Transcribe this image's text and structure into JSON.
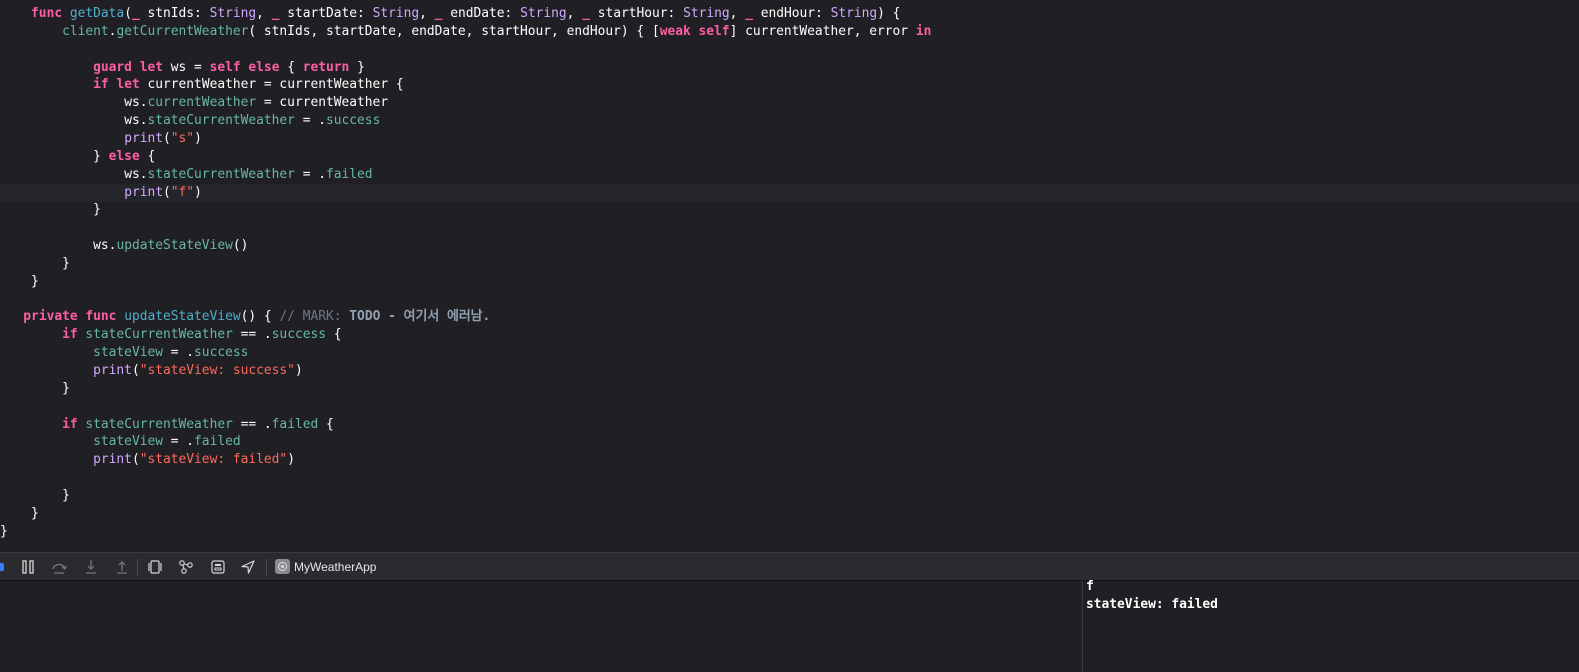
{
  "editor": {
    "current_line_index": 10,
    "lines": [
      [
        {
          "t": "    "
        },
        {
          "t": "func",
          "c": "kw"
        },
        {
          "t": " "
        },
        {
          "t": "getData",
          "c": "dc"
        },
        {
          "t": "("
        },
        {
          "t": "_",
          "c": "kw"
        },
        {
          "t": " stnIds: "
        },
        {
          "t": "String",
          "c": "ty"
        },
        {
          "t": ", "
        },
        {
          "t": "_",
          "c": "kw"
        },
        {
          "t": " startDate: "
        },
        {
          "t": "String",
          "c": "ty"
        },
        {
          "t": ", "
        },
        {
          "t": "_",
          "c": "kw"
        },
        {
          "t": " endDate: "
        },
        {
          "t": "String",
          "c": "ty"
        },
        {
          "t": ", "
        },
        {
          "t": "_",
          "c": "kw"
        },
        {
          "t": " startHour: "
        },
        {
          "t": "String",
          "c": "ty"
        },
        {
          "t": ", "
        },
        {
          "t": "_",
          "c": "kw"
        },
        {
          "t": " endHour: "
        },
        {
          "t": "String",
          "c": "ty"
        },
        {
          "t": ") {"
        }
      ],
      [
        {
          "t": "        "
        },
        {
          "t": "client",
          "c": "fn"
        },
        {
          "t": "."
        },
        {
          "t": "getCurrentWeather",
          "c": "fn"
        },
        {
          "t": "( stnIds, startDate, endDate, startHour, endHour) { ["
        },
        {
          "t": "weak",
          "c": "kw"
        },
        {
          "t": " "
        },
        {
          "t": "self",
          "c": "kw"
        },
        {
          "t": "] currentWeather, error "
        },
        {
          "t": "in",
          "c": "kw"
        }
      ],
      [],
      [
        {
          "t": "            "
        },
        {
          "t": "guard",
          "c": "kw"
        },
        {
          "t": " "
        },
        {
          "t": "let",
          "c": "kw"
        },
        {
          "t": " ws = "
        },
        {
          "t": "self",
          "c": "kw"
        },
        {
          "t": " "
        },
        {
          "t": "else",
          "c": "kw"
        },
        {
          "t": " { "
        },
        {
          "t": "return",
          "c": "kw"
        },
        {
          "t": " }"
        }
      ],
      [
        {
          "t": "            "
        },
        {
          "t": "if",
          "c": "kw"
        },
        {
          "t": " "
        },
        {
          "t": "let",
          "c": "kw"
        },
        {
          "t": " currentWeather = currentWeather {"
        }
      ],
      [
        {
          "t": "                "
        },
        {
          "t": "ws."
        },
        {
          "t": "currentWeather",
          "c": "fn"
        },
        {
          "t": " = currentWeather"
        }
      ],
      [
        {
          "t": "                "
        },
        {
          "t": "ws."
        },
        {
          "t": "stateCurrentWeather",
          "c": "fn"
        },
        {
          "t": " = ."
        },
        {
          "t": "success",
          "c": "fn"
        }
      ],
      [
        {
          "t": "                "
        },
        {
          "t": "print",
          "c": "ty"
        },
        {
          "t": "("
        },
        {
          "t": "\"s\"",
          "c": "st"
        },
        {
          "t": ")"
        }
      ],
      [
        {
          "t": "            } "
        },
        {
          "t": "else",
          "c": "kw"
        },
        {
          "t": " {"
        }
      ],
      [
        {
          "t": "                "
        },
        {
          "t": "ws."
        },
        {
          "t": "stateCurrentWeather",
          "c": "fn"
        },
        {
          "t": " = ."
        },
        {
          "t": "failed",
          "c": "fn"
        }
      ],
      [
        {
          "t": "                "
        },
        {
          "t": "print",
          "c": "ty"
        },
        {
          "t": "("
        },
        {
          "t": "\"f\"",
          "c": "st"
        },
        {
          "t": ")"
        }
      ],
      [
        {
          "t": "            }"
        }
      ],
      [],
      [
        {
          "t": "            "
        },
        {
          "t": "ws."
        },
        {
          "t": "updateStateView",
          "c": "fn"
        },
        {
          "t": "()"
        }
      ],
      [
        {
          "t": "        }"
        }
      ],
      [
        {
          "t": "    }"
        }
      ],
      [],
      [
        {
          "t": "   "
        },
        {
          "t": "private",
          "c": "kw"
        },
        {
          "t": " "
        },
        {
          "t": "func",
          "c": "kw"
        },
        {
          "t": " "
        },
        {
          "t": "updateStateView",
          "c": "dc"
        },
        {
          "t": "() { "
        },
        {
          "t": "// MARK: ",
          "c": "cm"
        },
        {
          "t": "TODO",
          "c": "mk"
        },
        {
          "t": " - 여기서 에러남.",
          "c": "mk"
        }
      ],
      [
        {
          "t": "        "
        },
        {
          "t": "if",
          "c": "kw"
        },
        {
          "t": " "
        },
        {
          "t": "stateCurrentWeather",
          "c": "fn"
        },
        {
          "t": " == ."
        },
        {
          "t": "success",
          "c": "fn"
        },
        {
          "t": " {"
        }
      ],
      [
        {
          "t": "            "
        },
        {
          "t": "stateView",
          "c": "fn"
        },
        {
          "t": " = ."
        },
        {
          "t": "success",
          "c": "fn"
        }
      ],
      [
        {
          "t": "            "
        },
        {
          "t": "print",
          "c": "ty"
        },
        {
          "t": "("
        },
        {
          "t": "\"stateView: success\"",
          "c": "st"
        },
        {
          "t": ")"
        }
      ],
      [
        {
          "t": "        }"
        }
      ],
      [],
      [
        {
          "t": "        "
        },
        {
          "t": "if",
          "c": "kw"
        },
        {
          "t": " "
        },
        {
          "t": "stateCurrentWeather",
          "c": "fn"
        },
        {
          "t": " == ."
        },
        {
          "t": "failed",
          "c": "fn"
        },
        {
          "t": " {"
        }
      ],
      [
        {
          "t": "            "
        },
        {
          "t": "stateView",
          "c": "fn"
        },
        {
          "t": " = ."
        },
        {
          "t": "failed",
          "c": "fn"
        }
      ],
      [
        {
          "t": "            "
        },
        {
          "t": "print",
          "c": "ty"
        },
        {
          "t": "("
        },
        {
          "t": "\"stateView: failed\"",
          "c": "st"
        },
        {
          "t": ")"
        }
      ],
      [],
      [
        {
          "t": "        }"
        }
      ],
      [
        {
          "t": "    }"
        }
      ],
      [
        {
          "t": "}"
        }
      ]
    ]
  },
  "debug_bar": {
    "buttons": [
      {
        "name": "toggle-breakpoints-icon"
      },
      {
        "name": "pause-icon"
      },
      {
        "name": "step-over-icon"
      },
      {
        "name": "step-into-icon"
      },
      {
        "name": "step-out-icon"
      },
      {
        "name": "debug-view-hierarchy-icon"
      },
      {
        "name": "memory-graph-icon"
      },
      {
        "name": "environment-overrides-icon"
      },
      {
        "name": "simulate-location-icon"
      }
    ],
    "app_name": "MyWeatherApp"
  },
  "console": {
    "lines": [
      "f",
      "stateView: failed"
    ]
  },
  "colors": {
    "background": "#1f1f24",
    "keyword": "#fc5fa3",
    "type": "#d0a8ff",
    "function": "#67b7a4",
    "declaration": "#4eb0cc",
    "string": "#fc6a5d",
    "comment": "#6c7986"
  }
}
